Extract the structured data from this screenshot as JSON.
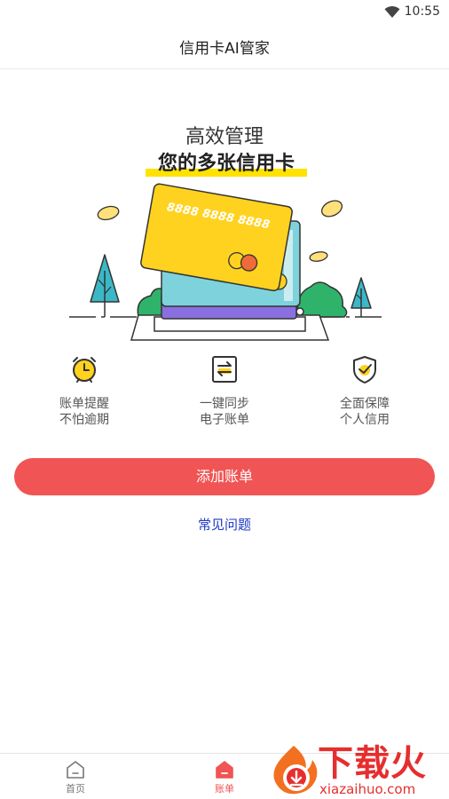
{
  "status_bar": {
    "time": "10:55"
  },
  "header": {
    "title": "信用卡AI管家"
  },
  "hero": {
    "title_line1": "高效管理",
    "title_line2": "您的多张信用卡",
    "card_number": "8888 8888 8888"
  },
  "features": [
    {
      "icon": "alarm-clock-icon",
      "line1": "账单提醒",
      "line2": "不怕逾期"
    },
    {
      "icon": "sync-bill-icon",
      "line1": "一键同步",
      "line2": "电子账单"
    },
    {
      "icon": "shield-check-icon",
      "line1": "全面保障",
      "line2": "个人信用"
    }
  ],
  "actions": {
    "add_bill": "添加账单",
    "faq": "常见问题"
  },
  "tab_bar": {
    "items": [
      {
        "label": "首页",
        "icon": "home-icon",
        "active": false
      },
      {
        "label": "账单",
        "icon": "bill-icon",
        "active": true
      }
    ]
  },
  "watermark": {
    "name": "下载火",
    "domain": "xiazaihuo.com"
  },
  "colors": {
    "accent": "#f05454",
    "highlight": "#ffe200",
    "link": "#1d39c4",
    "card_yellow": "#ffd21f",
    "card_blue": "#7ed2dc",
    "card_purple": "#8a6fe0",
    "tree_teal": "#3bb8c7",
    "bush_green": "#2fb36b"
  }
}
